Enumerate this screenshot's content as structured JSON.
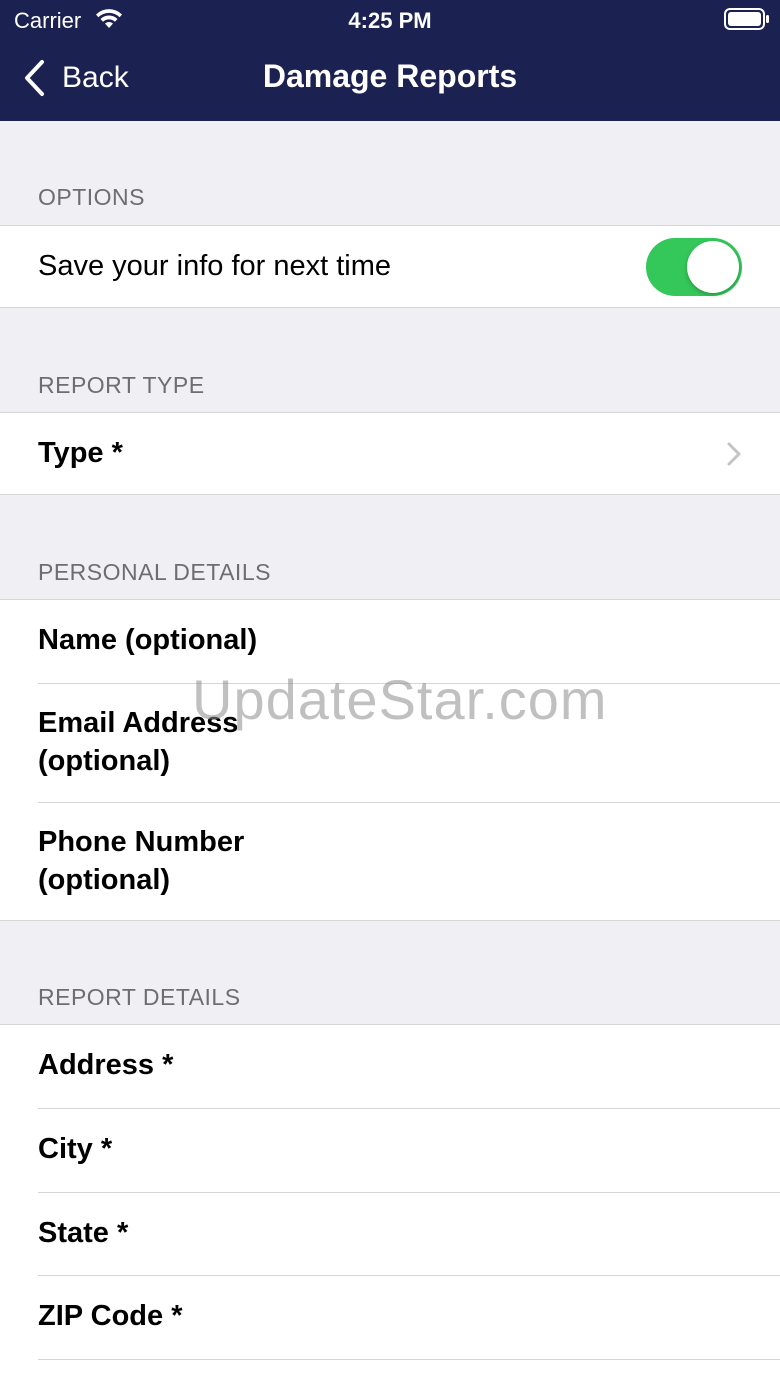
{
  "status_bar": {
    "carrier": "Carrier",
    "time": "4:25 PM"
  },
  "nav": {
    "back_label": "Back",
    "title": "Damage Reports"
  },
  "sections": {
    "options": {
      "header": "OPTIONS",
      "save_info_label": "Save your info for next time",
      "save_info_enabled": true
    },
    "report_type": {
      "header": "REPORT TYPE",
      "type_label": "Type *"
    },
    "personal_details": {
      "header": "PERSONAL DETAILS",
      "name_label": "Name (optional)",
      "email_label_line1": "Email Address",
      "email_label_line2": "(optional)",
      "phone_label_line1": "Phone Number",
      "phone_label_line2": "(optional)"
    },
    "report_details": {
      "header": "REPORT DETAILS",
      "address_label": "Address *",
      "city_label": "City *",
      "state_label": "State *",
      "zip_label": "ZIP Code *"
    }
  },
  "watermark": "UpdateStar.com",
  "colors": {
    "nav_background": "#1b2252",
    "toggle_on": "#34c759",
    "page_background": "#efeff4"
  }
}
